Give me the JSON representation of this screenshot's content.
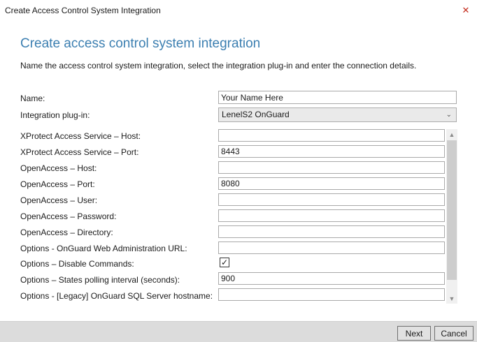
{
  "window": {
    "title": "Create Access Control System Integration",
    "close_glyph": "✕"
  },
  "heading": "Create access control system integration",
  "description": "Name the access control system integration, select the integration plug-in and enter the connection details.",
  "form": {
    "name": {
      "label": "Name:",
      "value": "Your Name Here"
    },
    "plugin": {
      "label": "Integration plug-in:",
      "value": "LenelS2 OnGuard"
    },
    "fields": [
      {
        "label": "XProtect Access Service – Host:",
        "value": ""
      },
      {
        "label": "XProtect Access Service – Port:",
        "value": "8443"
      },
      {
        "label": "OpenAccess – Host:",
        "value": ""
      },
      {
        "label": "OpenAccess – Port:",
        "value": "8080"
      },
      {
        "label": "OpenAccess – User:",
        "value": ""
      },
      {
        "label": "OpenAccess – Password:",
        "value": ""
      },
      {
        "label": "OpenAccess – Directory:",
        "value": ""
      },
      {
        "label": "Options - OnGuard Web Administration URL:",
        "value": ""
      }
    ],
    "disable_commands": {
      "label": "Options – Disable Commands:",
      "checked": true,
      "check_glyph": "✓"
    },
    "polling": {
      "label": "Options – States polling interval (seconds):",
      "value": "900"
    },
    "sql_host": {
      "label": "Options - [Legacy] OnGuard SQL Server hostname:",
      "value": ""
    }
  },
  "icons": {
    "close": "close-icon",
    "chevron": "chevron-down-icon",
    "scroll_up": "scroll-up-icon",
    "scroll_down": "scroll-down-icon",
    "check": "checkmark-icon"
  },
  "footer": {
    "next_label": "Next",
    "cancel_label": "Cancel"
  },
  "colors": {
    "heading": "#3c7fb1",
    "footer_bg": "#dcdcdc",
    "close": "#c42b1c"
  }
}
